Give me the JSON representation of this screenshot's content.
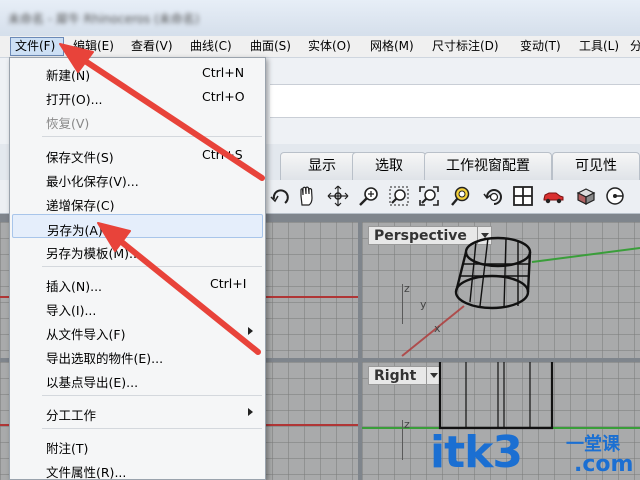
{
  "window": {
    "title": "未命名 - 犀牛 Rhinoceros (未命名)"
  },
  "menubar": {
    "items": [
      {
        "label": "文件(F)",
        "active": true
      },
      {
        "label": "编辑(E)"
      },
      {
        "label": "查看(V)"
      },
      {
        "label": "曲线(C)"
      },
      {
        "label": "曲面(S)"
      },
      {
        "label": "实体(O)"
      },
      {
        "label": "网格(M)"
      },
      {
        "label": "尺寸标注(D)"
      },
      {
        "label": "变动(T)"
      },
      {
        "label": "工具(L)"
      },
      {
        "label": "分"
      }
    ]
  },
  "file_menu": {
    "items": [
      {
        "label": "新建(N)",
        "shortcut": "Ctrl+N"
      },
      {
        "label": "打开(O)...",
        "shortcut": "Ctrl+O"
      },
      {
        "label": "恢复(V)",
        "disabled": true
      },
      {
        "label": "保存文件(S)",
        "shortcut": "Ctrl+S"
      },
      {
        "label": "最小化保存(V)..."
      },
      {
        "label": "递增保存(C)"
      },
      {
        "label": "另存为(A)",
        "highlighted": true
      },
      {
        "label": "另存为模板(M)..."
      },
      {
        "label": "插入(N)...",
        "shortcut": "Ctrl+I"
      },
      {
        "label": "导入(I)..."
      },
      {
        "label": "从文件导入(F)",
        "submenu": true
      },
      {
        "label": "导出选取的物件(E)..."
      },
      {
        "label": "以基点导出(E)..."
      },
      {
        "label": "分工工作",
        "submenu": true
      },
      {
        "label": "附注(T)"
      },
      {
        "label": "文件属性(R)..."
      }
    ]
  },
  "tabs": [
    {
      "label": "显示"
    },
    {
      "label": "选取"
    },
    {
      "label": "工作视窗配置"
    },
    {
      "label": "可见性"
    }
  ],
  "toolbar": {
    "icons": [
      "rotate-view-icon",
      "pan-hand-icon",
      "move-view-icon",
      "zoom-icon",
      "zoom-window-icon",
      "zoom-extents-icon",
      "zoom-selected-icon",
      "undo-view-icon",
      "four-viewports-icon",
      "car-render-icon",
      "shaded-icon",
      "rotate-cplane-icon"
    ]
  },
  "viewports": {
    "perspective": {
      "label": "Perspective"
    },
    "right": {
      "label": "Right"
    }
  },
  "axis_labels": {
    "x": "x",
    "y": "y",
    "z": "z"
  },
  "watermark": {
    "main": "itk3",
    "chinese": "一堂课",
    "domain": ".com"
  },
  "colors": {
    "accent_arrow": "#e8433a",
    "highlight": "#e5eefb",
    "watermark": "#1b6fd2",
    "x_axis": "#b03636",
    "y_axis": "#3a9e3a"
  }
}
